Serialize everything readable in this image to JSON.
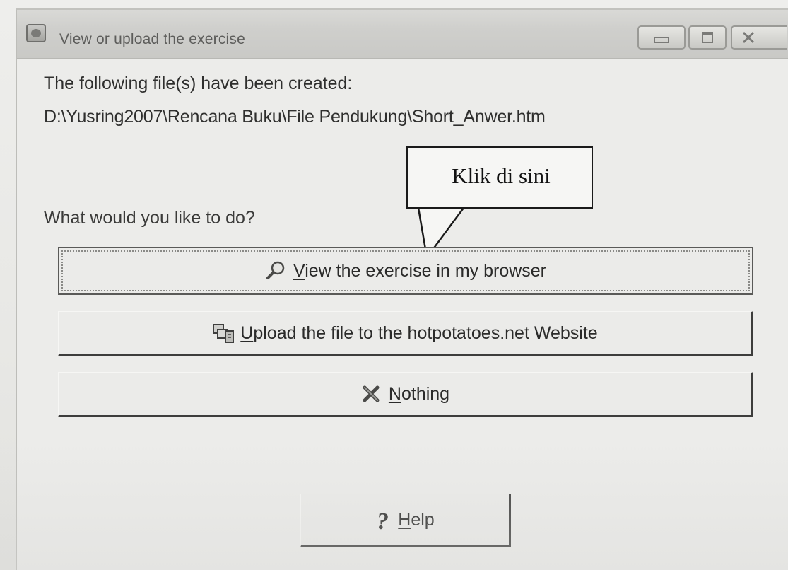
{
  "window": {
    "title": "View or upload the exercise"
  },
  "message": {
    "created_line": "The following file(s) have been created:",
    "file_path": "D:\\Yusring2007\\Rencana Buku\\File Pendukung\\Short_Anwer.htm",
    "question": "What would you like to do?"
  },
  "callout": {
    "text": "Klik di sini"
  },
  "buttons": {
    "view": {
      "mnemonic": "V",
      "rest": "iew the exercise in my browser",
      "icon": "magnifier-icon"
    },
    "upload": {
      "mnemonic": "U",
      "rest": "pload the file to the hotpotatoes.net Website",
      "icon": "upload-icon"
    },
    "nothing": {
      "mnemonic": "N",
      "rest": "othing",
      "icon": "x-mark-icon"
    },
    "help": {
      "mnemonic": "H",
      "rest": "elp",
      "icon": "question-mark-icon"
    }
  }
}
